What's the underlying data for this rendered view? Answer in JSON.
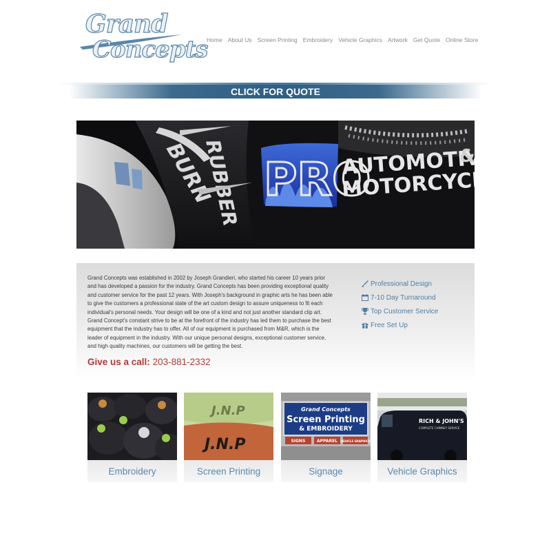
{
  "brand": {
    "logo_line1": "Grand",
    "logo_line2": "Concepts",
    "logo_color": "#5b87a8"
  },
  "nav": {
    "items": [
      {
        "label": "Home"
      },
      {
        "label": "About Us"
      },
      {
        "label": "Screen Printing"
      },
      {
        "label": "Embroidery"
      },
      {
        "label": "Vehicle Graphics"
      },
      {
        "label": "Artwork"
      },
      {
        "label": "Get Quote"
      },
      {
        "label": "Online Store"
      }
    ]
  },
  "quote_bar": {
    "label": "CLICK FOR QUOTE",
    "color": "#2f5f83"
  },
  "hero": {
    "text_burn": "BURN",
    "text_rubber": "RUBBER",
    "text_pro": "PRO",
    "text_automotive": "AUTOMOTIVE",
    "text_motorcycle": "MOTORCYCLE",
    "text_ampersand": "&"
  },
  "about": {
    "paragraph": "Grand Concepts was established in 2002 by Joseph Grandieri, who started his career 10 years prior and has developed a passion for the industry. Grand Concepts has been providing exceptional quality and customer service for the past 12 years. With Joseph's background in graphic arts he has been able to give the customers a professional state of the art custom design to assure uniqueness to fit each individual's personal needs. Your design will be one of a kind and not just another standard clip art. Grand Concept's constant strive to be at the forefront of the industry has led them to purchase the best equipment that the industry has to offer. All of our equipment is purchased from M&R, which is the leader of equipment in the industry. With our unique personal designs, exceptional customer service, and high quality machines, our customers will be getting the best.",
    "call_label": "Give us a call:",
    "call_phone": "203-881-2332",
    "call_color": "#b13a3a"
  },
  "features": [
    {
      "icon": "paintbrush-icon",
      "label": "Professional Design"
    },
    {
      "icon": "calendar-icon",
      "label": "7-10 Day Turnaround"
    },
    {
      "icon": "trophy-icon",
      "label": "Top Customer Service"
    },
    {
      "icon": "gift-icon",
      "label": "Free Set Up"
    }
  ],
  "services": [
    {
      "label": "Embroidery"
    },
    {
      "label": "Screen Printing",
      "thumb_text1": "J.N.P",
      "thumb_text2": "J.N.P"
    },
    {
      "label": "Signage",
      "thumb_line1": "Grand Concepts",
      "thumb_line2": "Screen Printing",
      "thumb_line3": "& EMBROIDERY",
      "thumb_sign1": "SIGNS",
      "thumb_sign2": "APPAREL",
      "thumb_sign3": "VEHICLE GRAPHICS"
    },
    {
      "label": "Vehicle Graphics",
      "thumb_van_text": "RICH & JOHN'S",
      "thumb_van_sub": "COMPLETE CHIMNEY SERVICE"
    }
  ],
  "accent_color": "#5c88aa"
}
